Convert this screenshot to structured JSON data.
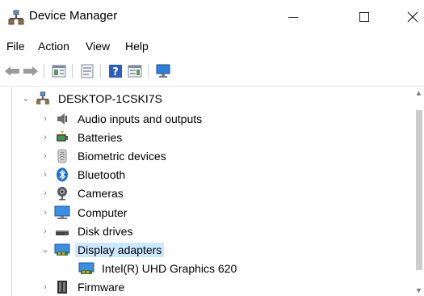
{
  "window": {
    "title": "Device Manager",
    "app_icon": "device-manager-icon"
  },
  "menu": {
    "items": [
      "File",
      "Action",
      "View",
      "Help"
    ]
  },
  "toolbar": {
    "icons": [
      "back-arrow-icon",
      "forward-arrow-icon",
      "show-hide-console-tree-icon",
      "properties-icon",
      "help-icon",
      "action-pane-icon",
      "monitor-icon"
    ]
  },
  "tree": {
    "root": {
      "label": "DESKTOP-1CSKI7S",
      "expanded": true
    },
    "items": [
      {
        "label": "Audio inputs and outputs",
        "icon": "speaker-icon",
        "expanded": false
      },
      {
        "label": "Batteries",
        "icon": "battery-icon",
        "expanded": false
      },
      {
        "label": "Biometric devices",
        "icon": "fingerprint-icon",
        "expanded": false
      },
      {
        "label": "Bluetooth",
        "icon": "bluetooth-icon",
        "expanded": false
      },
      {
        "label": "Cameras",
        "icon": "camera-icon",
        "expanded": false
      },
      {
        "label": "Computer",
        "icon": "computer-icon",
        "expanded": false
      },
      {
        "label": "Disk drives",
        "icon": "disk-drive-icon",
        "expanded": false
      },
      {
        "label": "Display adapters",
        "icon": "display-adapter-icon",
        "expanded": true,
        "selected": true
      },
      {
        "label": "Intel(R) UHD Graphics 620",
        "icon": "display-adapter-icon",
        "child": true
      },
      {
        "label": "Firmware",
        "icon": "firmware-icon",
        "expanded": false
      }
    ]
  },
  "colors": {
    "selection": "#cce8ff",
    "bluetooth": "#1f6fd6",
    "monitor": "#2f7fd8"
  }
}
